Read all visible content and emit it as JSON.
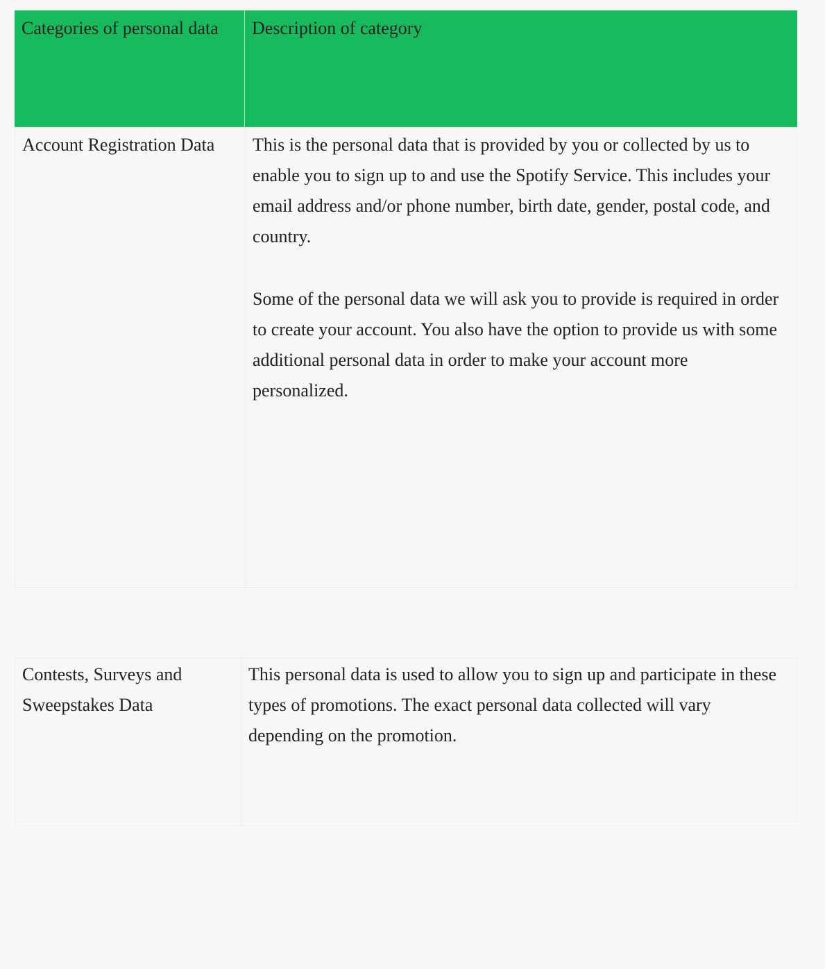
{
  "table": {
    "header": {
      "col1": "Categories of personal data",
      "col2": "Description of category"
    },
    "rows": [
      {
        "category": "Account Registration Data",
        "description": [
          "This is the personal data that is provided by you or collected by us to enable you to sign up to and use the Spotify Service. This includes your email address and/or phone number, birth date, gender, postal code, and country.",
          "Some of the personal data we will ask you to provide is required in order to create your account. You also have the option to provide us with some additional personal data in order to make your account more personalized."
        ]
      },
      {
        "category": "Contests, Surveys and Sweepstakes Data",
        "description": [
          "This personal data is used to allow you to sign up and participate in these types of promotions. The exact personal data collected will vary depending on the promotion."
        ]
      }
    ]
  },
  "colors": {
    "header_background": "#18ba5e",
    "page_background": "#f7f7f7",
    "text": "#222222"
  }
}
